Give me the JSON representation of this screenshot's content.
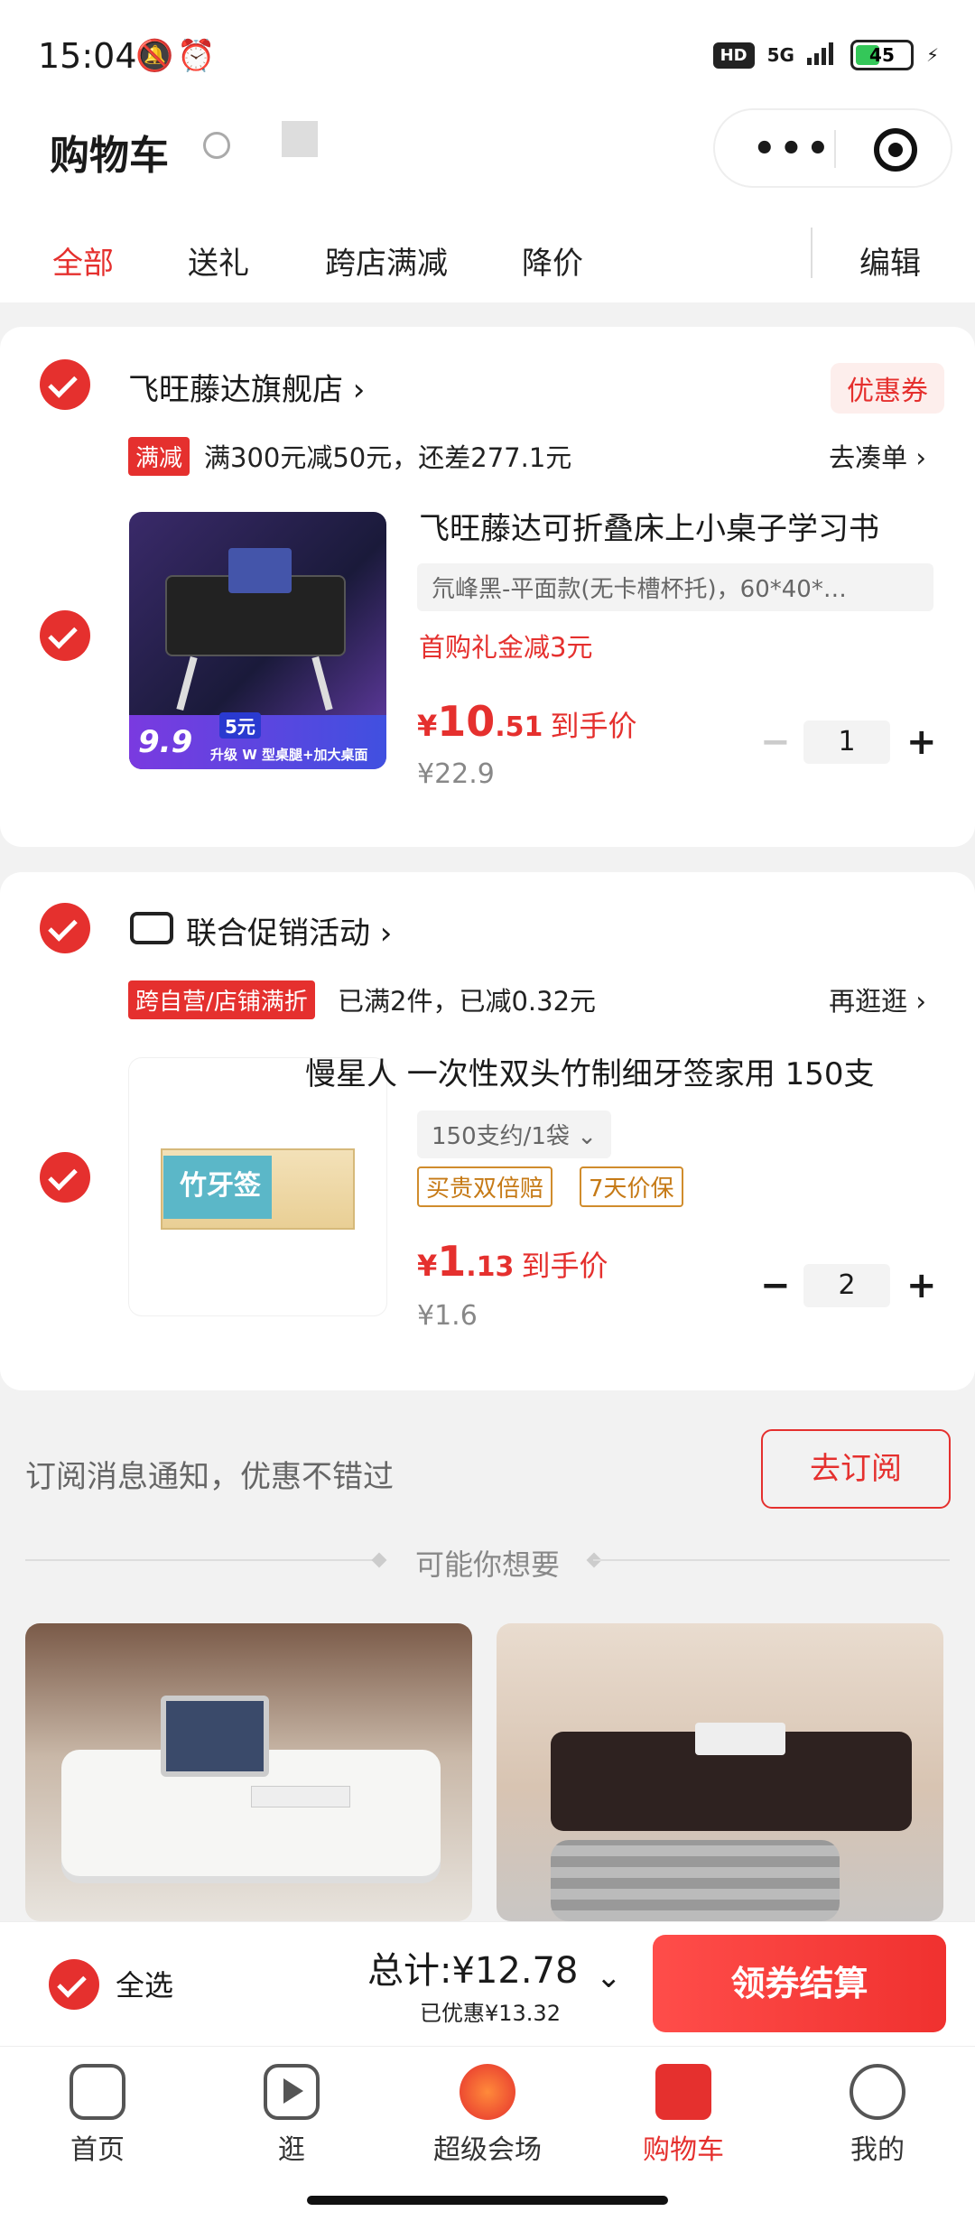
{
  "status_bar": {
    "time": "15:04",
    "network": "5G",
    "battery": "45",
    "hd": "HD"
  },
  "header": {
    "title": "购物车",
    "capsule_more": "•••"
  },
  "tabs": [
    {
      "label": "全部",
      "active": true
    },
    {
      "label": "送礼"
    },
    {
      "label": "跨店满减"
    },
    {
      "label": "降价"
    },
    {
      "label": "编辑"
    }
  ],
  "store1": {
    "name": "飞旺藤达旗舰店 ›",
    "coupon": "优惠券",
    "promo_tag": "满减",
    "promo_text": "满300元减50元，还差277.1元",
    "promo_link": "去凑单 ›",
    "product": {
      "title": "飞旺藤达可折叠床上小桌子学习书",
      "sku": "氘峰黑-平面款(无卡槽杯托)，60*40*…",
      "first_buy": "首购礼金减3元",
      "price_yen": "¥",
      "price_int": "10",
      "price_dec": ".51",
      "price_label": "到手价",
      "orig_price": "¥22.9",
      "qty": "1",
      "img_badge_price": "9.9",
      "img_badge_coupon": "5元",
      "img_badge_text": "升级 W 型桌腿+加大桌面"
    }
  },
  "store2": {
    "name": "联合促销活动 ›",
    "promo_tag": "跨自营/店铺满折",
    "promo_text": "已满2件，已减0.32元",
    "promo_link": "再逛逛 ›",
    "product": {
      "title": "慢星人 一次性双头竹制细牙签家用 150支",
      "sku": "150支约/1袋  ⌄",
      "tag1": "买贵双倍赔",
      "tag2": "7天价保",
      "price_yen": "¥",
      "price_int": "1",
      "price_dec": ".13",
      "price_label": "到手价",
      "orig_price": "¥1.6",
      "qty": "2",
      "img_text": "竹牙签"
    }
  },
  "subscribe": {
    "text": "订阅消息通知，优惠不错过",
    "button": "去订阅"
  },
  "recommend": {
    "title": "可能你想要"
  },
  "checkout": {
    "select_all": "全选",
    "total": "总计:¥12.78",
    "saved": "已优惠¥13.32",
    "button": "领券结算"
  },
  "nav": [
    {
      "label": "首页"
    },
    {
      "label": "逛"
    },
    {
      "label": "超级会场"
    },
    {
      "label": "购物车",
      "active": true
    },
    {
      "label": "我的"
    }
  ]
}
